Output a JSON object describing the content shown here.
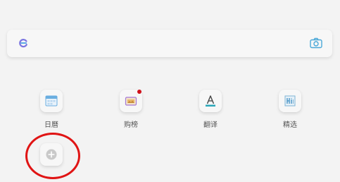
{
  "search_bar": {
    "logo_icon": "app-logo-e-icon",
    "camera_icon": "camera-icon"
  },
  "shortcuts": [
    {
      "label": "日曆",
      "icon": "calendar-icon"
    },
    {
      "label": "购榜",
      "icon": "shopping-list-icon",
      "has_badge": true
    },
    {
      "label": "翻译",
      "icon": "translate-icon"
    },
    {
      "label": "精选",
      "icon": "featured-icon"
    }
  ],
  "add_tile": {
    "icon": "add-circle-icon"
  },
  "colors": {
    "accent": "#4aa8d8",
    "badge": "#d0111b",
    "highlight_circle": "#e01414"
  }
}
